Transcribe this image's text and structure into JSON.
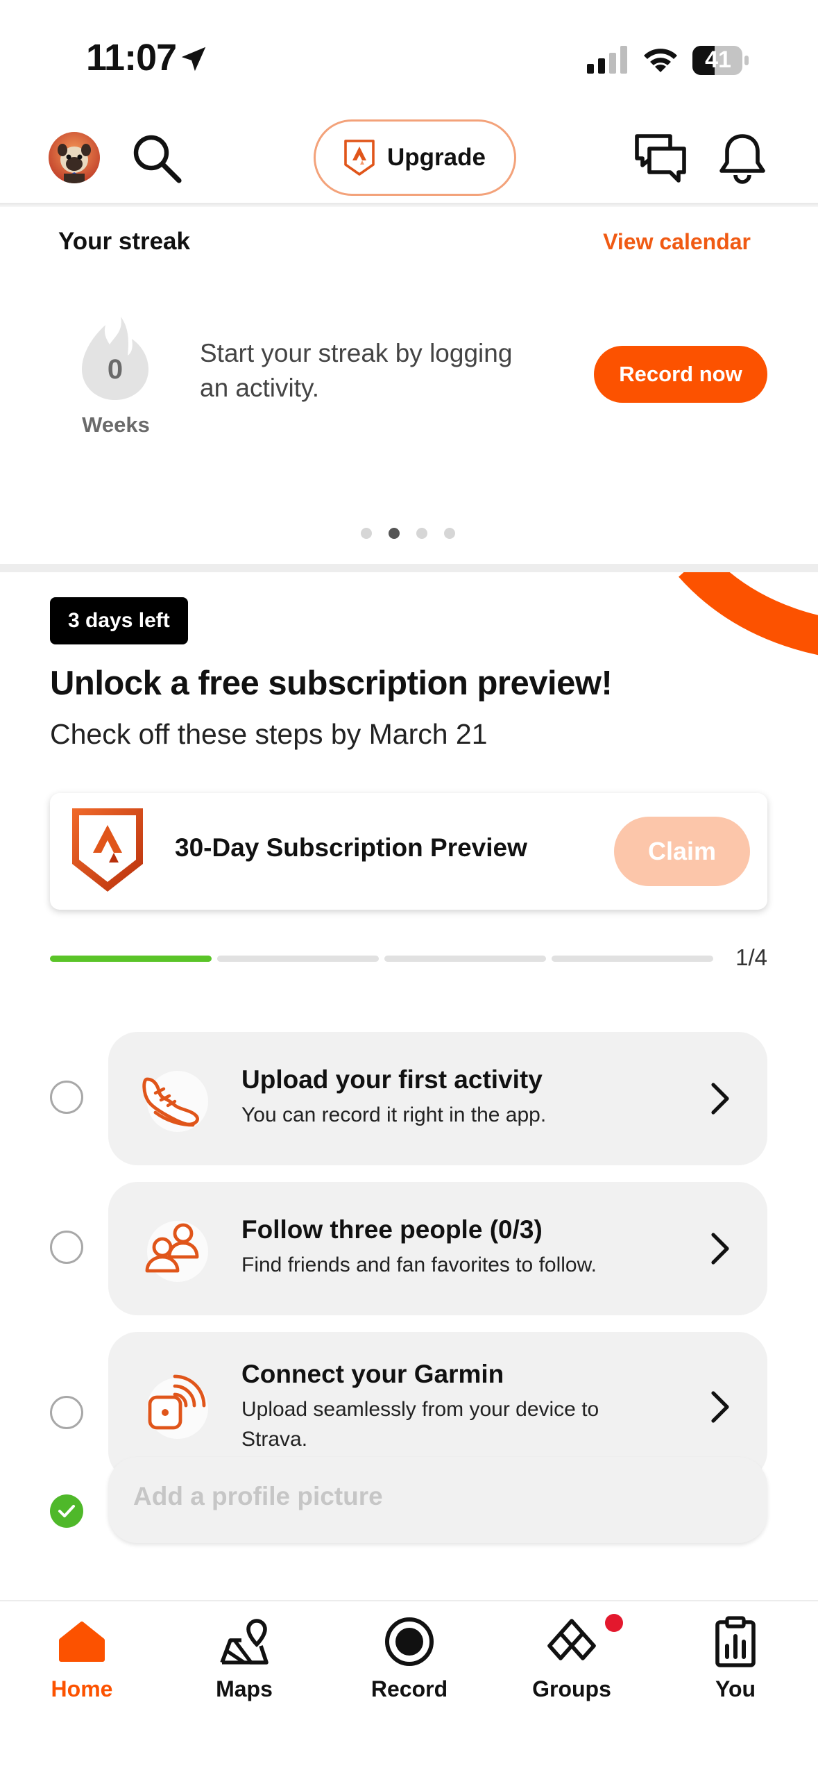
{
  "status_bar": {
    "time": "11:07",
    "battery": "41"
  },
  "header": {
    "upgrade_label": "Upgrade"
  },
  "streak": {
    "title": "Your streak",
    "view_calendar": "View calendar",
    "count": "0",
    "unit": "Weeks",
    "message": "Start your streak by logging an activity.",
    "record_button": "Record now",
    "page_index": 2,
    "page_count": 4
  },
  "promo": {
    "badge": "3 days left",
    "title": "Unlock a free subscription preview!",
    "subtitle": "Check off these steps by March 21",
    "reward_label": "30-Day Subscription Preview",
    "claim_label": "Claim",
    "progress_text": "1/4",
    "progress_done": 1,
    "progress_total": 4
  },
  "steps": [
    {
      "title": "Upload your first activity",
      "desc": "You can record it right in the app.",
      "done": false,
      "icon": "shoe-icon"
    },
    {
      "title": "Follow three people (0/3)",
      "desc": "Find friends and fan favorites to follow.",
      "done": false,
      "icon": "people-icon"
    },
    {
      "title": "Connect your Garmin",
      "desc": "Upload seamlessly from your device to Strava.",
      "done": false,
      "icon": "device-icon"
    },
    {
      "title": "Add a profile picture",
      "done": true
    }
  ],
  "tabs": [
    {
      "label": "Home",
      "icon": "home-icon",
      "active": true
    },
    {
      "label": "Maps",
      "icon": "maps-icon"
    },
    {
      "label": "Record",
      "icon": "record-icon"
    },
    {
      "label": "Groups",
      "icon": "groups-icon",
      "notification": true
    },
    {
      "label": "You",
      "icon": "you-icon"
    }
  ],
  "colors": {
    "accent": "#fc5200",
    "success": "#5ac428",
    "notification": "#e3182d"
  }
}
